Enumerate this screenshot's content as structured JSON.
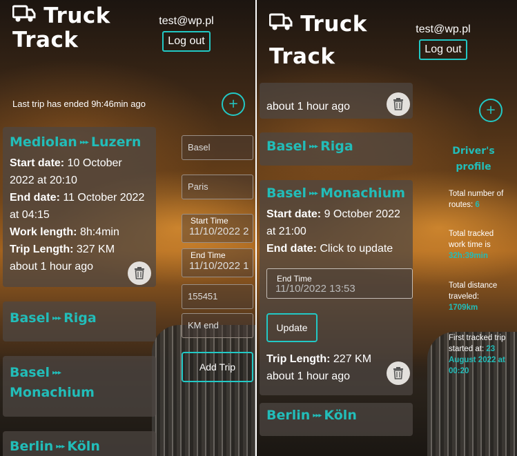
{
  "app": {
    "brand_line1": "Truck",
    "brand_line2": "Track",
    "user_email": "test@wp.pl",
    "logout_label": "Log out",
    "accent_color": "#22c9c6"
  },
  "left": {
    "status": "Last trip has ended 9h:46min ago",
    "add_label": "+",
    "trips": [
      {
        "from": "Mediolan",
        "to": "Luzern",
        "start_label": "Start date:",
        "start_value": "10 October 2022 at 20:10",
        "end_label": "End date:",
        "end_value": "11 October 2022 at 04:15",
        "work_label": "Work length:",
        "work_value": "8h:4min",
        "length_label": "Trip Length:",
        "length_value": "327 KM",
        "ago": "about 1 hour ago"
      },
      {
        "from": "Basel",
        "to": "Riga"
      },
      {
        "from": "Basel",
        "to": "Monachium"
      },
      {
        "from": "Berlin",
        "to": "Köln"
      }
    ],
    "form": {
      "from_value": "Basel",
      "to_value": "Paris",
      "start_time_label": "Start Time",
      "start_time_value": "11/10/2022 2",
      "end_time_label": "End Time",
      "end_time_value": "11/10/2022 1",
      "number_value": "155451",
      "km_end_placeholder": "KM end",
      "add_trip_label": "Add Trip"
    }
  },
  "right": {
    "add_label": "+",
    "top_card_ago": "about 1 hour ago",
    "trips": [
      {
        "from": "Basel",
        "to": "Riga"
      },
      {
        "from": "Basel",
        "to": "Monachium",
        "start_label": "Start date:",
        "start_value": "9 October 2022 at 21:00",
        "end_label": "End date:",
        "end_value": "Click to update",
        "end_time_label": "End Time",
        "end_time_value": "11/10/2022 13:53",
        "update_label": "Update",
        "length_label": "Trip Length:",
        "length_value": "227 KM",
        "ago": "about 1 hour ago"
      },
      {
        "from": "Berlin",
        "to": "Köln"
      }
    ],
    "profile": {
      "title_line1": "Driver's",
      "title_line2": "profile",
      "routes_label": "Total number of routes:",
      "routes_value": "6",
      "work_label": "Total tracked work time is",
      "work_value": "32h:39min",
      "distance_label": "Total distance traveled:",
      "distance_value": "1709km",
      "first_label": "First tracked trip started at:",
      "first_value": "23 August 2022 at 00:20"
    }
  }
}
